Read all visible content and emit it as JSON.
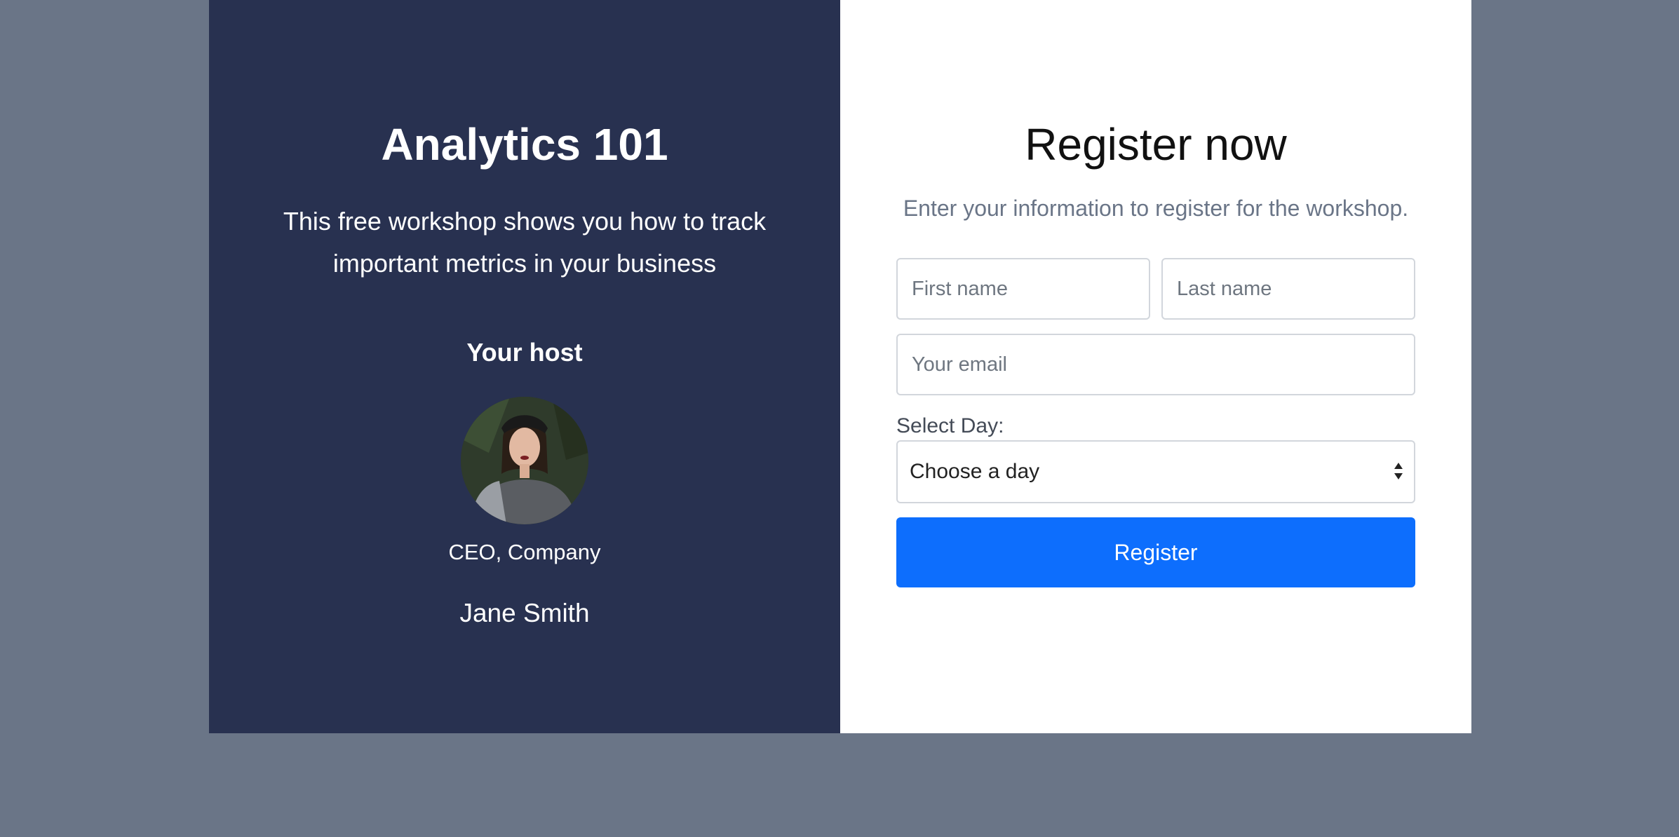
{
  "workshop": {
    "title": "Analytics 101",
    "description": "This free workshop shows you how to track important metrics in your business"
  },
  "host": {
    "heading": "Your host",
    "role": "CEO, Company",
    "name": "Jane Smith"
  },
  "form": {
    "title": "Register now",
    "subtitle": "Enter your information to register for the workshop.",
    "first_name_placeholder": "First name",
    "last_name_placeholder": "Last name",
    "email_placeholder": "Your email",
    "select_label": "Select Day:",
    "select_value": "Choose a day",
    "submit_label": "Register"
  },
  "colors": {
    "page_background": "#6a7587",
    "left_panel": "#283150",
    "accent": "#0d6efd"
  }
}
